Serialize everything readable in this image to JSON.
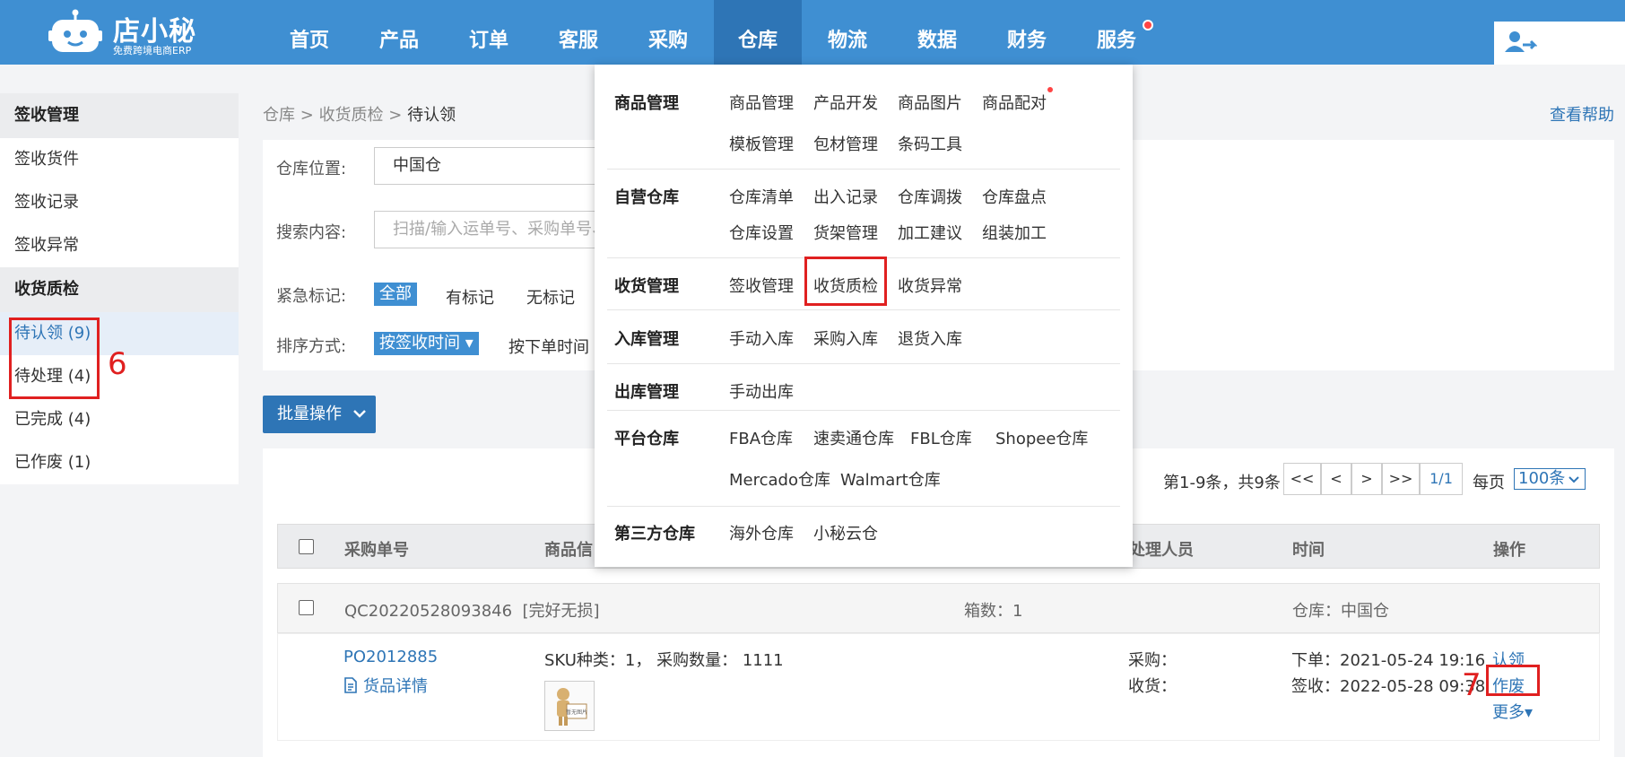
{
  "brand": {
    "name": "店小秘",
    "tagline": "免费跨境电商ERP"
  },
  "nav": [
    "首页",
    "产品",
    "订单",
    "客服",
    "采购",
    "仓库",
    "物流",
    "数据",
    "财务",
    "服务"
  ],
  "sidebar": {
    "section1": "签收管理",
    "items1": [
      "签收货件",
      "签收记录",
      "签收异常"
    ],
    "section2": "收货质检",
    "items2": [
      "待认领 (9)",
      "待处理 (4)",
      "已完成 (4)",
      "已作废 (1)"
    ]
  },
  "breadcrumb": {
    "p1": "仓库",
    "sep": ">",
    "p2": "收货质检",
    "p3": "待认领"
  },
  "help": "查看帮助",
  "filters": {
    "warehouse_label": "仓库位置:",
    "warehouse_value": "中国仓",
    "search_label": "搜索内容:",
    "search_placeholder": "扫描/输入运单号、采购单号、",
    "urgent_label": "紧急标记:",
    "urgent_options": [
      "全部",
      "有标记",
      "无标记"
    ],
    "sort_label": "排序方式:",
    "sort_options": [
      "按签收时间 ▾",
      "按下单时间"
    ]
  },
  "batch_button": "批量操作",
  "pager": {
    "info": "第1-9条，共9条",
    "buttons": [
      "<<",
      "<",
      ">",
      ">>"
    ],
    "page": "1/1",
    "per_page_label": "每页",
    "per_page_value": "100条"
  },
  "table": {
    "headers": [
      "采购单号",
      "商品信",
      "处理人员",
      "时间",
      "操作"
    ]
  },
  "group": {
    "id": "QC20220528093846",
    "status": "[完好无损]",
    "boxes": "箱数：1",
    "warehouse": "仓库：中国仓"
  },
  "row": {
    "po": "PO2012885",
    "goods_detail": "货品详情",
    "sku_info": "SKU种类：1，  采购数量：  1111",
    "purchase_label": "采购：",
    "receive_label": "收货：",
    "order_time": "下单：2021-05-24 19:16",
    "sign_time": "签收：2022-05-28 09:38",
    "actions": [
      "认领",
      "作废",
      "更多▾"
    ],
    "thumb_text": "暂无图片"
  },
  "annotations": [
    "6",
    "7"
  ],
  "dropdown": {
    "groups": [
      {
        "title": "商品管理",
        "items": [
          "商品管理",
          "产品开发",
          "商品图片",
          "商品配对",
          "模板管理",
          "包材管理",
          "条码工具"
        ]
      },
      {
        "title": "自营仓库",
        "items": [
          "仓库清单",
          "出入记录",
          "仓库调拨",
          "仓库盘点",
          "仓库设置",
          "货架管理",
          "加工建议",
          "组装加工"
        ]
      },
      {
        "title": "收货管理",
        "items": [
          "签收管理",
          "收货质检",
          "收货异常"
        ]
      },
      {
        "title": "入库管理",
        "items": [
          "手动入库",
          "采购入库",
          "退货入库"
        ]
      },
      {
        "title": "出库管理",
        "items": [
          "手动出库"
        ]
      },
      {
        "title": "平台仓库",
        "items": [
          "FBA仓库",
          "速卖通仓库",
          "FBL仓库",
          "Shopee仓库",
          "Mercado仓库",
          "Walmart仓库"
        ]
      },
      {
        "title": "第三方仓库",
        "items": [
          "海外仓库",
          "小秘云仓"
        ]
      }
    ]
  },
  "colors": {
    "primary": "#3f8fd2",
    "nav_active": "#2e75b6",
    "highlight": "#e02020"
  }
}
